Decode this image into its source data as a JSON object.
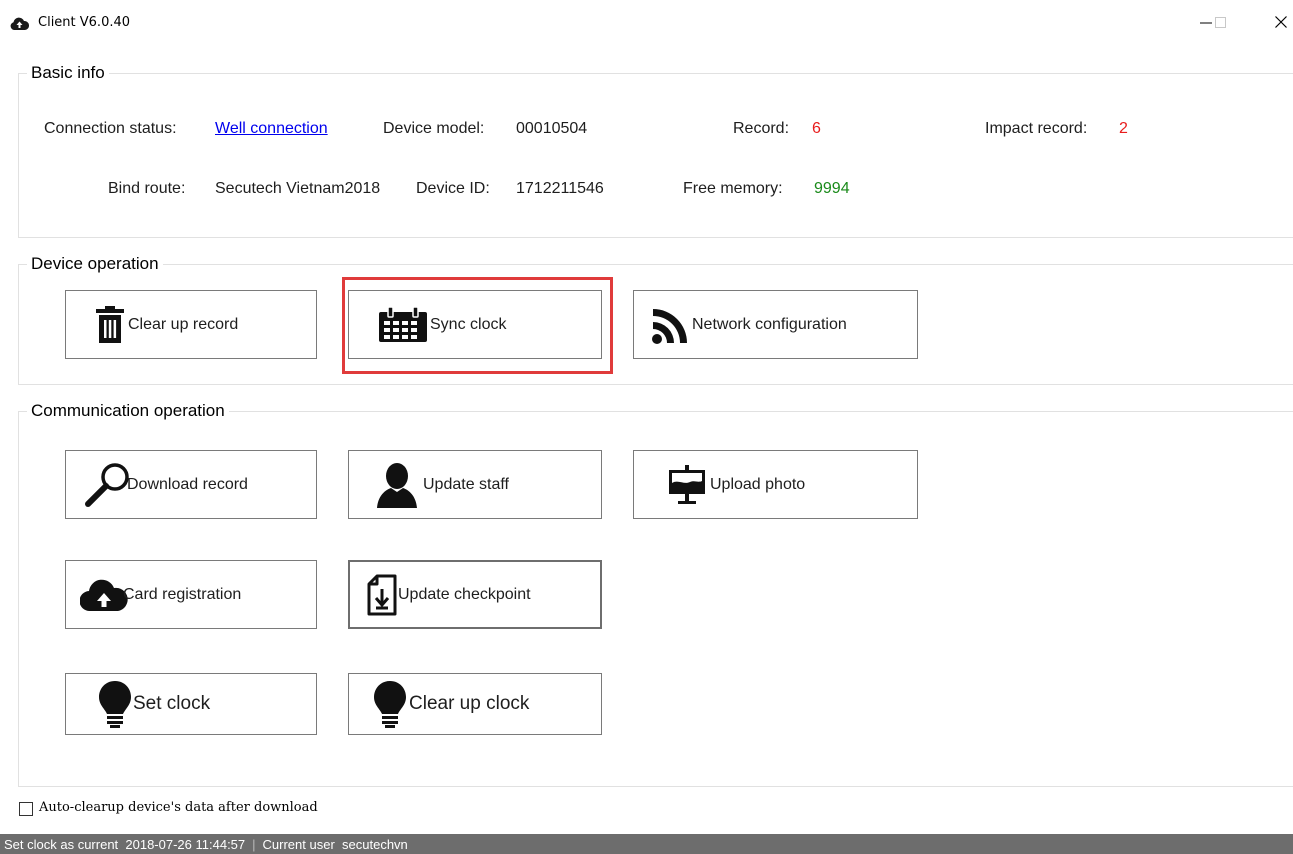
{
  "window": {
    "title": "Client V6.0.40"
  },
  "basic_info": {
    "legend": "Basic info",
    "connection_status_label": "Connection status:",
    "connection_status_value": "Well connection",
    "device_model_label": "Device model:",
    "device_model_value": "00010504",
    "record_label": "Record:",
    "record_value": "6",
    "impact_record_label": "Impact record:",
    "impact_record_value": "2",
    "bind_route_label": "Bind route:",
    "bind_route_value": "Secutech Vietnam2018",
    "device_id_label": "Device ID:",
    "device_id_value": "1712211546",
    "free_memory_label": "Free memory:",
    "free_memory_value": "9994"
  },
  "device_operation": {
    "legend": "Device operation",
    "clear_up_record": "Clear up record",
    "sync_clock": "Sync clock",
    "network_configuration": "Network configuration"
  },
  "communication_operation": {
    "legend": "Communication operation",
    "download_record": "Download record",
    "update_staff": "Update staff",
    "upload_photo": "Upload photo",
    "card_registration": "Card registration",
    "update_checkpoint": "Update checkpoint",
    "set_clock": "Set clock",
    "clear_up_clock": "Clear up clock"
  },
  "options": {
    "auto_clearup_label": "Auto-clearup device's data after download",
    "auto_clearup_checked": false
  },
  "status_bar": {
    "action": "Set clock as current",
    "timestamp": "2018-07-26 11:44:57",
    "separator": "|",
    "current_user_label": "Current user",
    "current_user_value": "secutechvn"
  },
  "colors": {
    "link": "#0000ee",
    "count_red": "#e81c1c",
    "memory_green": "#1a8a1a",
    "highlight_border": "#e03b3b",
    "status_bar_bg": "#6d6d6d"
  },
  "icons": {
    "app": "cloud-upload-icon",
    "clear_up_record": "trash-icon",
    "sync_clock": "calendar-icon",
    "network_configuration": "rss-icon",
    "download_record": "search-icon",
    "update_staff": "user-icon",
    "upload_photo": "presentation-icon",
    "card_registration": "cloud-upload-icon",
    "update_checkpoint": "file-download-icon",
    "set_clock": "lightbulb-icon",
    "clear_up_clock": "lightbulb-icon"
  }
}
